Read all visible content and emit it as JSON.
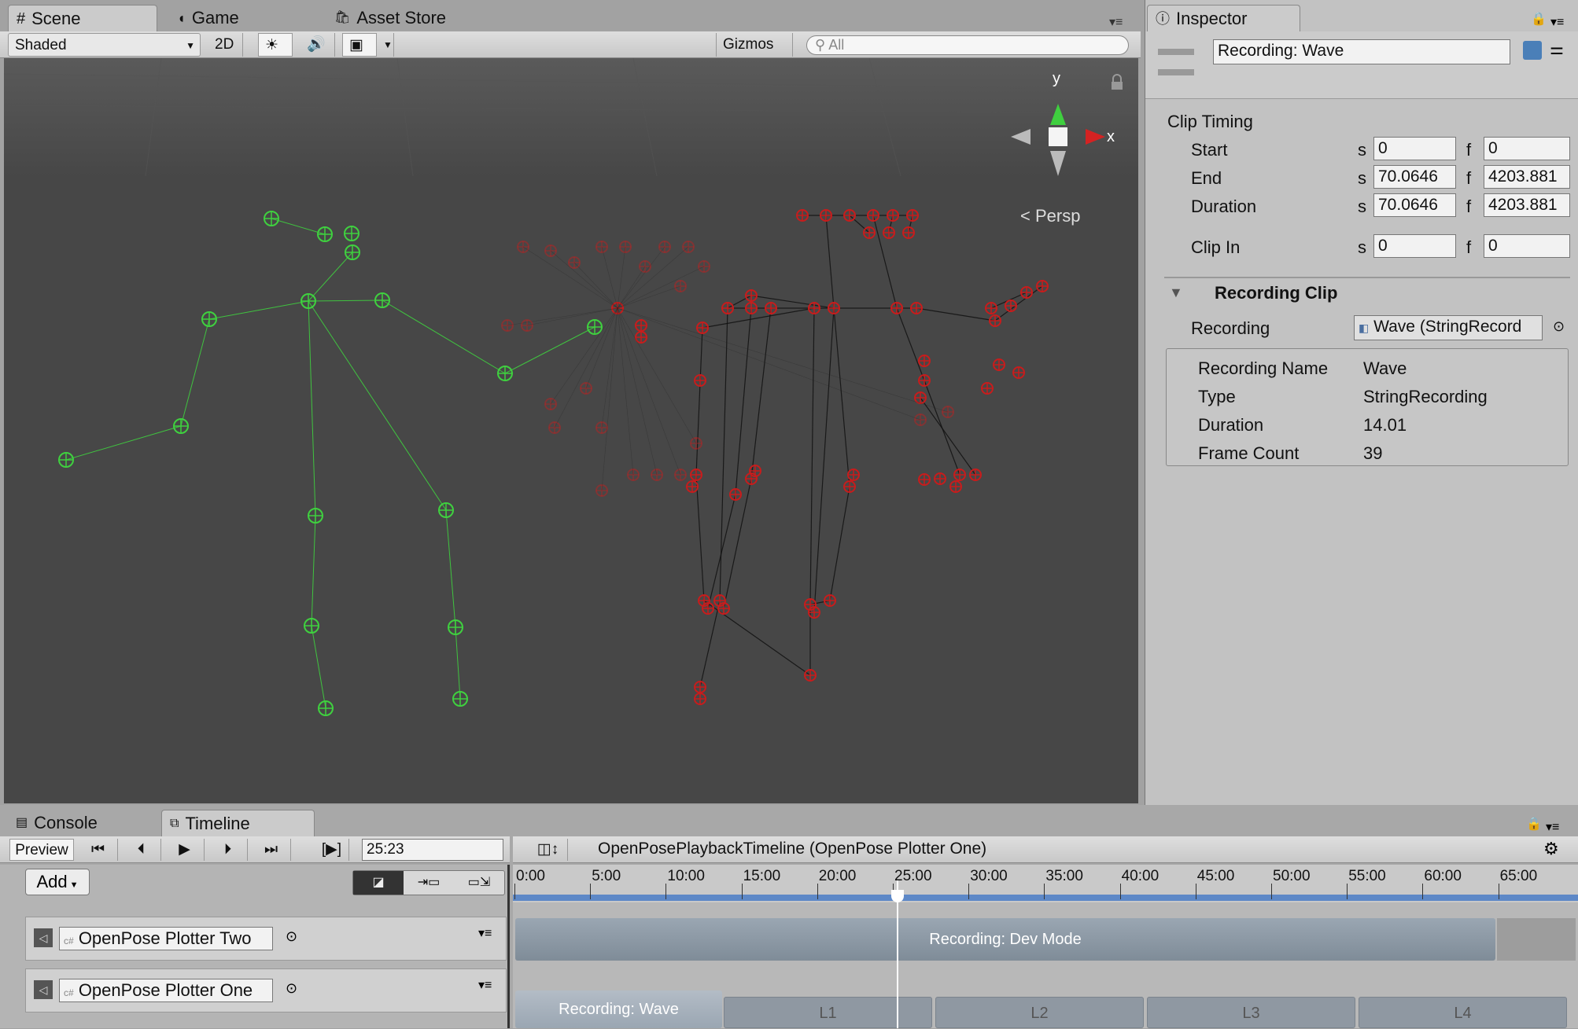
{
  "scene": {
    "tabs": [
      {
        "label": "Scene",
        "icon": "hash-icon"
      },
      {
        "label": "Game",
        "icon": "pacman-icon"
      },
      {
        "label": "Asset Store",
        "icon": "shopping-bag-icon"
      }
    ],
    "shading_mode": "Shaded",
    "mode_2d": "2D",
    "gizmos_label": "Gizmos",
    "search_placeholder": "All",
    "gizmo_axes": {
      "y": "y",
      "x": "x"
    },
    "projection_label": "Persp"
  },
  "inspector": {
    "tab_label": "Inspector",
    "object_name": "Recording: Wave",
    "clip_timing": {
      "header": "Clip Timing",
      "rows": [
        {
          "label": "Start",
          "s_prefix": "s",
          "s_value": "0",
          "f_prefix": "f",
          "f_value": "0"
        },
        {
          "label": "End",
          "s_prefix": "s",
          "s_value": "70.0646",
          "f_prefix": "f",
          "f_value": "4203.881"
        },
        {
          "label": "Duration",
          "s_prefix": "s",
          "s_value": "70.0646",
          "f_prefix": "f",
          "f_value": "4203.881"
        },
        {
          "label": "Clip In",
          "s_prefix": "s",
          "s_value": "0",
          "f_prefix": "f",
          "f_value": "0"
        }
      ]
    },
    "recording_clip": {
      "header": "Recording Clip",
      "recording_label": "Recording",
      "recording_value": "Wave (StringRecord",
      "details": [
        {
          "label": "Recording Name",
          "value": "Wave"
        },
        {
          "label": "Type",
          "value": "StringRecording"
        },
        {
          "label": "Duration",
          "value": "14.01"
        },
        {
          "label": "Frame Count",
          "value": "39"
        }
      ]
    }
  },
  "bottom": {
    "tabs": [
      {
        "label": "Console",
        "icon": "console-icon"
      },
      {
        "label": "Timeline",
        "icon": "timeline-icon"
      }
    ],
    "preview_label": "Preview",
    "time_value": "25:23",
    "timeline_name": "OpenPosePlaybackTimeline (OpenPose Plotter One)",
    "add_label": "Add",
    "ruler_labels": [
      "0:00",
      "5:00",
      "10:00",
      "15:00",
      "20:00",
      "25:00",
      "30:00",
      "35:00",
      "40:00",
      "45:00",
      "50:00",
      "55:00",
      "60:00",
      "65:00"
    ],
    "tracks": [
      {
        "name": "OpenPose Plotter Two",
        "clip": "Recording: Dev Mode"
      },
      {
        "name": "OpenPose Plotter One",
        "clip": "Recording: Wave",
        "loops": [
          "L1",
          "L2",
          "L3",
          "L4"
        ]
      }
    ]
  },
  "colors": {
    "green_skeleton": "#3fd13f",
    "red_skeleton": "#c81c1c",
    "viewport": "#474747",
    "playhead": "#ffffff"
  }
}
